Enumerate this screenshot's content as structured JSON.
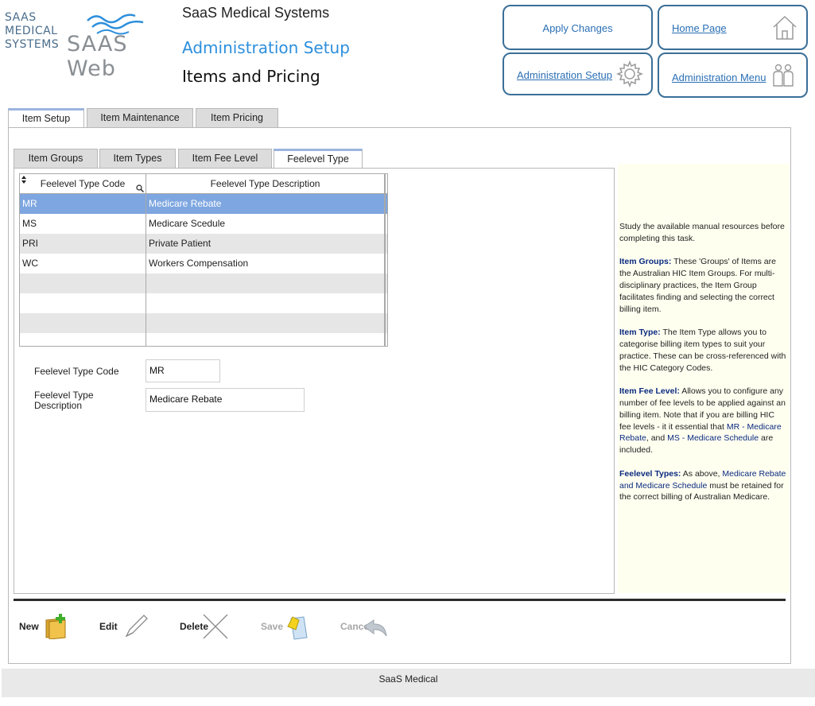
{
  "header": {
    "logo_text": "SAAS\nMEDICAL\nSYSTEMS",
    "logo_word": "SAAS Web",
    "company": "SaaS Medical Systems",
    "section": "Administration Setup",
    "page_title": "Items and Pricing"
  },
  "nav": {
    "apply": "Apply Changes",
    "home": "Home Page",
    "admin_setup": "Administration Setup",
    "admin_menu": "Administration Menu"
  },
  "tabs": {
    "main": [
      "Item Setup",
      "Item Maintenance",
      "Item Pricing"
    ],
    "sub": [
      "Item Groups",
      "Item Types",
      "Item Fee Level",
      "Feelevel Type"
    ]
  },
  "grid": {
    "col1": "Feelevel Type Code",
    "col2": "Feelevel Type Description",
    "rows": [
      {
        "code": "MR",
        "desc": "Medicare Rebate"
      },
      {
        "code": "MS",
        "desc": "Medicare Scedule"
      },
      {
        "code": "PRI",
        "desc": "Private Patient"
      },
      {
        "code": "WC",
        "desc": "Workers Compensation"
      },
      {
        "code": "",
        "desc": ""
      },
      {
        "code": "",
        "desc": ""
      },
      {
        "code": "",
        "desc": ""
      },
      {
        "code": "",
        "desc": ""
      }
    ]
  },
  "form": {
    "code_label": "Feelevel Type Code",
    "code_value": "MR",
    "desc_label": "Feelevel Type Description",
    "desc_value": "Medicare Rebate"
  },
  "help": {
    "intro": "Study the available manual resources before completing this task.",
    "groups_title": "Item Groups:",
    "groups_text": "These 'Groups' of Items are the Australian HIC Item Groups. For multi-disciplinary practices, the Item Group facilitates finding and selecting the correct billing item.",
    "type_title": "Item Type:",
    "type_text": "The Item Type allows you to categorise billing item types to suit your practice. These can be cross-referenced with the HIC Category Codes.",
    "fee_title": "Item Fee Level:",
    "fee_text_1": "Allows you to configure any number of fee levels to be applied against an billing item. Note that if you are billing HIC fee levels - it it essential that",
    "fee_hl_1": "MR - Medicare Rebate",
    "fee_text_2": ", and",
    "fee_hl_2": "MS - Medicare Schedule",
    "fee_text_3": "are included.",
    "types_title": "Feelevel Types:",
    "types_text_1": "As above,",
    "types_hl": "Medicare Rebate and Medicare Schedule",
    "types_text_2": "must be retained for the correct billing of Australian Medicare."
  },
  "toolbar": {
    "new": "New",
    "edit": "Edit",
    "delete": "Delete",
    "save": "Save",
    "cancel": "Cancel"
  },
  "footer": "SaaS Medical",
  "colors": {
    "accent": "#2d8fdc",
    "nav_border": "#3a6f98",
    "selected_row": "#7ea6e0",
    "help_bg": "#fffff0"
  }
}
